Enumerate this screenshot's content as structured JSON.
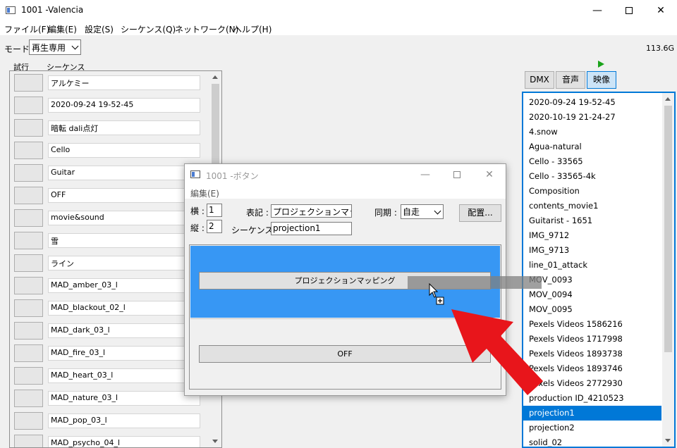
{
  "window": {
    "title": "1001 -Valencia"
  },
  "menubar": [
    "ファイル(F)",
    "編集(E)",
    "設定(S)",
    "シーケンス(Q)",
    "ネットワーク(N)",
    "ヘルプ(H)"
  ],
  "mode": {
    "label": "モード :",
    "value": "再生専用"
  },
  "storage": "113.6G",
  "columns": {
    "try": "試行",
    "sequence": "シーケンス"
  },
  "sequences": [
    "アルケミー",
    "2020-09-24 19-52-45",
    "暗転 dali点灯",
    "Cello",
    "Guitar",
    "OFF",
    "movie&sound",
    "雪",
    "ライン",
    "MAD_amber_03_l",
    "MAD_blackout_02_l",
    "MAD_dark_03_l",
    "MAD_fire_03_l",
    "MAD_heart_03_l",
    "MAD_nature_03_l",
    "MAD_pop_03_l",
    "MAD_psycho_04_l"
  ],
  "tabs": [
    "DMX",
    "音声",
    "映像"
  ],
  "active_tab": "映像",
  "media_items": [
    "2020-09-24 19-52-45",
    "2020-10-19 21-24-27",
    "4.snow",
    "Agua-natural",
    "Cello - 33565",
    "Cello - 33565-4k",
    "Composition",
    "contents_movie1",
    "Guitarist - 1651",
    "IMG_9712",
    "IMG_9713",
    "line_01_attack",
    "MOV_0093",
    "MOV_0094",
    "MOV_0095",
    "Pexels Videos 1586216",
    "Pexels Videos 1717998",
    "Pexels Videos 1893738",
    "Pexels Videos 1893746",
    "Pexels Videos 2772930",
    "production ID_4210523",
    "projection1",
    "projection2",
    "solid_02"
  ],
  "selected_media": "projection1",
  "dialog": {
    "title": "1001 -ボタン",
    "menu": "編集(E)",
    "cols_label": "横 :",
    "cols_value": "1",
    "rows_label": "縦 :",
    "rows_value": "2",
    "display_label": "表記 :",
    "display_value": "プロジェクションマッピング",
    "sequence_label": "シーケンス :",
    "sequence_value": "projection1",
    "sync_label": "同期 :",
    "sync_value": "自走",
    "layout_button": "配置...",
    "buttons": [
      "プロジェクションマッピング",
      "OFF"
    ]
  },
  "colors": {
    "accent": "#0078d7",
    "cell_highlight": "#3797f4",
    "arrow": "#e8151b",
    "play": "#1aa31a"
  }
}
